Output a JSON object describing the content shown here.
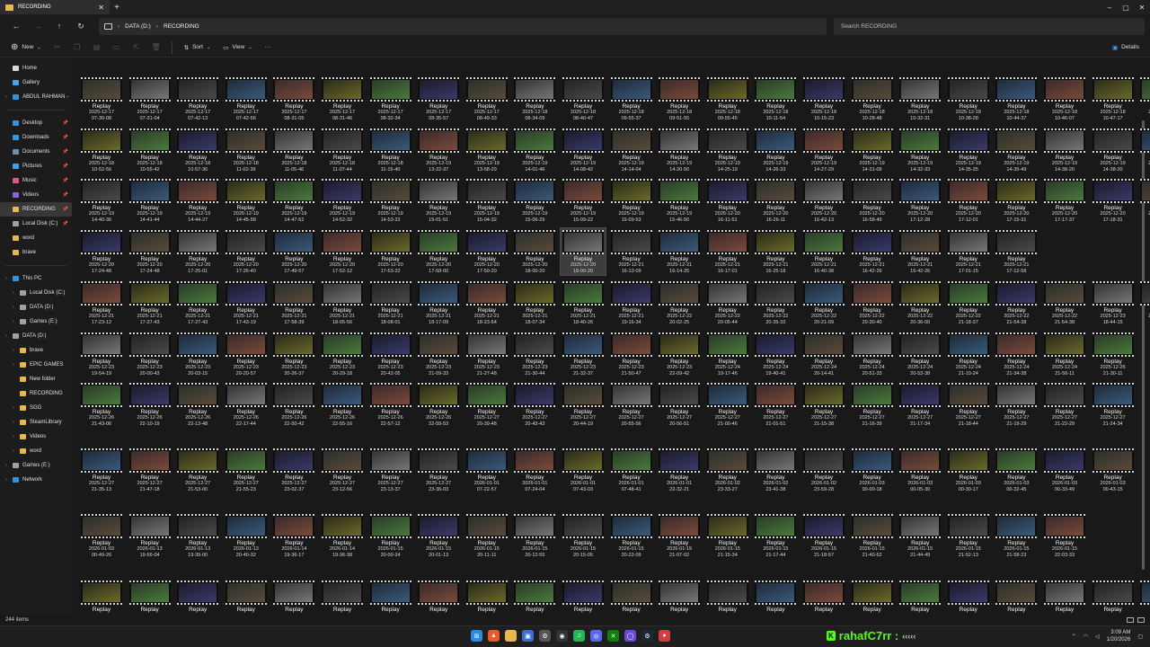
{
  "window": {
    "tab_title": "RECORDING",
    "new_tab": "+",
    "controls": [
      "–",
      "▢",
      "✕"
    ]
  },
  "address": {
    "path": [
      "DATA (D:)",
      "RECORDING"
    ],
    "search_placeholder": "Search RECORDING"
  },
  "command_bar": {
    "new_label": "New",
    "sort_label": "Sort",
    "view_label": "View",
    "more_label": "···",
    "details_label": "Details"
  },
  "sidebar": {
    "items": [
      {
        "label": "Home",
        "color": "#d8d8d8",
        "pin": false,
        "arrow": false,
        "indent": 0
      },
      {
        "label": "Gallery",
        "color": "#4aa3e8",
        "pin": false,
        "arrow": false,
        "indent": 0
      },
      {
        "label": "ABDUL RAHMAN -",
        "color": "#3b8fd9",
        "pin": false,
        "arrow": true,
        "indent": 0
      },
      {
        "label": "---"
      },
      {
        "label": "Desktop",
        "color": "#3b8fd9",
        "pin": true,
        "arrow": false,
        "indent": 0
      },
      {
        "label": "Downloads",
        "color": "#2d9be0",
        "pin": true,
        "arrow": false,
        "indent": 0
      },
      {
        "label": "Documents",
        "color": "#6c8fb0",
        "pin": true,
        "arrow": false,
        "indent": 0
      },
      {
        "label": "Pictures",
        "color": "#3fa1e6",
        "pin": true,
        "arrow": false,
        "indent": 0
      },
      {
        "label": "Music",
        "color": "#e05a7b",
        "pin": true,
        "arrow": false,
        "indent": 0
      },
      {
        "label": "Videos",
        "color": "#8a64d8",
        "pin": true,
        "arrow": false,
        "indent": 0
      },
      {
        "label": "RECORDING",
        "color": "#e8b84a",
        "pin": true,
        "arrow": false,
        "indent": 0,
        "selected": true
      },
      {
        "label": "Local Disk (C:)",
        "color": "#9aa3ad",
        "pin": true,
        "arrow": false,
        "indent": 0
      },
      {
        "label": "word",
        "color": "#e8b84a",
        "pin": false,
        "arrow": false,
        "indent": 0
      },
      {
        "label": "brave",
        "color": "#e8b84a",
        "pin": false,
        "arrow": false,
        "indent": 0
      },
      {
        "label": "---"
      },
      {
        "label": "This PC",
        "color": "#3b8fd9",
        "pin": false,
        "arrow": true,
        "indent": 0
      },
      {
        "label": "Local Disk (C:)",
        "color": "#9aa3ad",
        "pin": false,
        "arrow": true,
        "indent": 1
      },
      {
        "label": "DATA (D:)",
        "color": "#9aa3ad",
        "pin": false,
        "arrow": true,
        "indent": 1
      },
      {
        "label": "Games (E:)",
        "color": "#9aa3ad",
        "pin": false,
        "arrow": true,
        "indent": 1
      },
      {
        "label": "DATA (D:)",
        "color": "#9aa3ad",
        "pin": false,
        "arrow": true,
        "indent": 0
      },
      {
        "label": "brave",
        "color": "#e8b84a",
        "pin": false,
        "arrow": true,
        "indent": 1
      },
      {
        "label": "EPIC GAMES",
        "color": "#e8b84a",
        "pin": false,
        "arrow": true,
        "indent": 1
      },
      {
        "label": "New folder",
        "color": "#e8b84a",
        "pin": false,
        "arrow": false,
        "indent": 1
      },
      {
        "label": "RECORDING",
        "color": "#e8b84a",
        "pin": false,
        "arrow": false,
        "indent": 1
      },
      {
        "label": "SGG",
        "color": "#e8b84a",
        "pin": false,
        "arrow": true,
        "indent": 1
      },
      {
        "label": "SteamLibrary",
        "color": "#e8b84a",
        "pin": false,
        "arrow": true,
        "indent": 1
      },
      {
        "label": "Videos",
        "color": "#e8b84a",
        "pin": false,
        "arrow": true,
        "indent": 1
      },
      {
        "label": "word",
        "color": "#e8b84a",
        "pin": false,
        "arrow": true,
        "indent": 1
      },
      {
        "label": "Games (E:)",
        "color": "#9aa3ad",
        "pin": false,
        "arrow": true,
        "indent": 0
      },
      {
        "label": "Network",
        "color": "#3b8fd9",
        "pin": false,
        "arrow": true,
        "indent": 0
      }
    ]
  },
  "grid": {
    "file_label": "Replay",
    "selected": [
      3,
      10
    ],
    "rows": [
      [
        "2025-12-17|07-30-08",
        "2025-12-17|07-31-04",
        "2025-12-17|07-42-13",
        "2025-12-17|07-42-56",
        "2025-12-17|08-31-05",
        "2025-12-17|08-31-46",
        "2025-12-17|08-32-34",
        "2025-12-17|08-35-57",
        "2025-12-17|08-49-33",
        "2025-12-18|08-34-09",
        "2025-12-18|08-40-47",
        "2025-12-18|09-55-37",
        "2025-12-18|09-51-55",
        "2025-12-18|09-55-45",
        "2025-12-18|10-11-54",
        "2025-12-18|10-15-23",
        "2025-12-18|10-28-48",
        "2025-12-18|10-32-31",
        "2025-12-18|10-38-28",
        "2025-12-18|10-44-37",
        "2025-12-18|10-46-07",
        "2025-12-18|10-47-17",
        "2025-12-18|10-52-08"
      ],
      [
        "2025-12-18|10-52-56",
        "2025-12-18|10-55-42",
        "2025-12-18|10-57-36",
        "2025-12-18|11-02-39",
        "2025-12-18|11-05-46",
        "2025-12-18|11-07-44",
        "2025-12-18|11-15-40",
        "2025-12-19|13-22-37",
        "2025-12-19|13-58-29",
        "2025-12-19|14-01-46",
        "2025-12-19|14-08-42",
        "2025-12-19|14-14-04",
        "2025-12-19|14-20-50",
        "2025-12-19|14-25-19",
        "2025-12-19|14-26-33",
        "2025-12-19|14-27-29",
        "2025-12-19|14-31-09",
        "2025-12-19|14-32-33",
        "2025-12-19|14-35-35",
        "2025-12-19|14-35-49",
        "2025-12-19|14-38-20",
        "2025-12-19|14-38-20",
        "2025-12-19|14-39-25"
      ],
      [
        "2025-12-19|14-40-36",
        "2025-12-19|14-41-44",
        "2025-12-19|14-44-27",
        "2025-12-19|14-45-58",
        "2025-12-19|14-47-52",
        "2025-12-19|14-52-32",
        "2025-12-19|14-53-22",
        "2025-12-19|15-01-51",
        "2025-12-19|15-04-32",
        "2025-12-19|15-06-29",
        "2025-12-19|15-09-22",
        "2025-12-19|15-09-53",
        "2025-12-19|15-46-50",
        "2025-12-20|16-11-51",
        "2025-12-20|16-26-11",
        "2025-12-20|16-42-13",
        "2025-12-20|16-58-49",
        "2025-12-20|17-12-28",
        "2025-12-20|17-12-01",
        "2025-12-20|17-15-31",
        "2025-12-20|17-17-37",
        "2025-12-20|17-18-31",
        "2025-12-20|17-24-24"
      ],
      [
        "2025-12-20|17-24-48",
        "2025-12-20|17-24-48",
        "2025-12-20|17-25-01",
        "2025-12-20|17-26-40",
        "2025-12-20|17-49-57",
        "2025-12-20|17-52-12",
        "2025-12-20|17-53-22",
        "2025-12-20|17-58-00",
        "2025-12-20|17-59-20",
        "2025-12-20|18-00-20",
        "2025-12-20|18-00-20",
        "2025-12-21|16-13-09",
        "2025-12-21|16-14-25",
        "2025-12-21|16-17-01",
        "2025-12-21|16-25-18",
        "2025-12-21|16-40-38",
        "2025-12-21|16-42-26",
        "2025-12-21|16-42-26",
        "2025-12-21|17-01-15",
        "2025-12-21|17-12-58"
      ],
      [
        "2025-12-21|17-23-12",
        "2025-12-21|17-27-43",
        "2025-12-21|17-27-43",
        "2025-12-21|17-43-19",
        "2025-12-21|17-58-39",
        "2025-12-21|18-05-56",
        "2025-12-21|18-08-01",
        "2025-12-21|18-17-09",
        "2025-12-21|18-23-54",
        "2025-12-21|18-07-34",
        "2025-12-21|18-40-26",
        "2025-12-21|19-16-34",
        "2025-12-22|20-02-25",
        "2025-12-22|20-05-44",
        "2025-12-22|20-35-32",
        "2025-12-22|20-21-09",
        "2025-12-22|20-30-40",
        "2025-12-22|20-36-00",
        "2025-12-22|21-18-37",
        "2025-12-22|21-54-38",
        "2025-12-22|21-54-38",
        "2025-12-23|18-44-15",
        "2025-12-23|19-52-23"
      ],
      [
        "2025-12-23|19-54-19",
        "2025-12-23|20-00-43",
        "2025-12-23|20-03-15",
        "2025-12-23|20-20-57",
        "2025-12-23|20-26-37",
        "2025-12-23|20-29-18",
        "2025-12-23|20-42-05",
        "2025-12-23|21-09-33",
        "2025-12-23|21-27-48",
        "2025-12-23|21-30-44",
        "2025-12-23|21-32-37",
        "2025-12-23|21-50-47",
        "2025-12-23|22-09-42",
        "2025-12-24|19-17-46",
        "2025-12-24|19-40-41",
        "2025-12-24|20-14-41",
        "2025-12-24|20-51-33",
        "2025-12-24|20-53-38",
        "2025-12-24|21-10-24",
        "2025-12-24|21-34-38",
        "2025-12-24|21-56-11",
        "2025-12-26|21-30-11"
      ],
      [
        "2025-12-26|21-43-06",
        "2025-12-26|22-10-19",
        "2025-12-26|22-13-48",
        "2025-12-26|22-17-44",
        "2025-12-26|22-50-42",
        "2025-12-26|22-55-16",
        "2025-12-26|22-57-12",
        "2025-12-26|22-59-53",
        "2025-12-27|20-39-48",
        "2025-12-27|20-43-43",
        "2025-12-27|20-44-19",
        "2025-12-27|20-55-56",
        "2025-12-27|20-56-51",
        "2025-12-27|21-00-46",
        "2025-12-27|21-01-51",
        "2025-12-27|21-15-38",
        "2025-12-27|21-16-39",
        "2025-12-27|21-17-34",
        "2025-12-27|21-18-44",
        "2025-12-27|21-19-29",
        "2025-12-27|21-22-29",
        "2025-12-27|21-24-34"
      ],
      [
        "2025-12-27|21-35-13",
        "2025-12-27|21-47-18",
        "2025-12-27|21-53-00",
        "2025-12-27|21-55-23",
        "2025-12-27|23-02-37",
        "2025-12-27|23-12-56",
        "2025-12-27|23-13-37",
        "2025-12-27|23-36-03",
        "2026-01-01|07-22-57",
        "2026-01-01|07-24-04",
        "2026-01-01|07-43-03",
        "2026-01-01|07-48-41",
        "2026-01-01|22-32-21",
        "2026-01-02|23-33-27",
        "2026-01-02|23-41-38",
        "2026-01-02|23-59-28",
        "2026-01-03|00-00-18",
        "2026-01-03|00-05-30",
        "2026-01-03|00-30-17",
        "2026-01-03|00-32-45",
        "2026-01-03|00-33-49",
        "2026-01-03|00-43-15"
      ],
      [
        "2026-01-03|00-49-26",
        "2026-01-13|19-56-04",
        "2026-01-13|19-39-00",
        "2026-01-13|20-40-32",
        "2026-01-14|19-36-17",
        "2026-01-14|19-36-38",
        "2026-01-15|20-00-24",
        "2026-01-15|20-01-13",
        "2026-01-15|20-11-11",
        "2026-01-15|20-12-55",
        "2026-01-15|20-15-05",
        "2026-01-15|20-22-09",
        "2026-01-15|21-07-02",
        "2026-01-15|21-15-34",
        "2026-01-15|21-17-44",
        "2026-01-15|21-18-57",
        "2026-01-15|21-40-52",
        "2026-01-15|21-44-49",
        "2026-01-15|21-52-13",
        "2026-01-15|21-58-23",
        "2026-01-15|22-03-33"
      ],
      [
        "",
        "",
        "",
        "",
        "",
        "",
        "",
        "",
        "",
        "",
        "",
        "",
        "",
        "",
        "",
        "",
        "",
        "",
        "",
        "",
        "",
        "",
        ""
      ]
    ]
  },
  "status": {
    "item_count": "244 items"
  },
  "taskbar": {
    "kick_handle": "rahafC7rr :",
    "kick_dots": "‹‹‹‹‹",
    "time": "3:09 AM",
    "date": "1/20/2026"
  }
}
